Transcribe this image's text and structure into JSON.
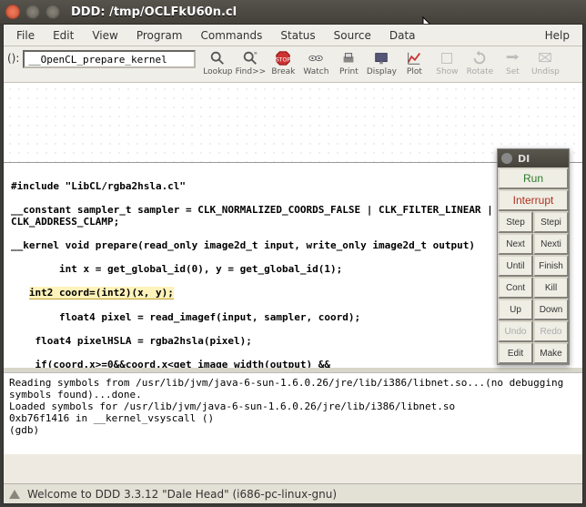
{
  "title": "DDD: /tmp/OCLFkU60n.cl",
  "menubar": [
    "File",
    "Edit",
    "View",
    "Program",
    "Commands",
    "Status",
    "Source",
    "Data"
  ],
  "menubar_help": "Help",
  "func_label": "():",
  "func_input_value": "__OpenCL_prepare_kernel",
  "toolbar": {
    "lookup": "Lookup",
    "find": "Find>>",
    "break": "Break",
    "watch": "Watch",
    "print": "Print",
    "display": "Display",
    "plot": "Plot",
    "show": "Show",
    "rotate": "Rotate",
    "set": "Set",
    "undisp": "Undisp"
  },
  "source_lines": [
    "",
    "#include \"LibCL/rgba2hsla.cl\"",
    "",
    "__constant sampler_t sampler = CLK_NORMALIZED_COORDS_FALSE | CLK_FILTER_LINEAR | ",
    "CLK_ADDRESS_CLAMP;",
    "",
    "__kernel void prepare(read_only image2d_t input, write_only image2d_t output)",
    "",
    "        int x = get_global_id(0), y = get_global_id(1);",
    "",
    "   int2 coord=(int2)(x, y);",
    "",
    "        float4 pixel = read_imagef(input, sampler, coord);",
    "",
    "    float4 pixelHSLA = rgba2hsla(pixel);",
    "",
    "    if(coord.x>=0&&coord.x<get_image_width(output) &&"
  ],
  "highlight_line_index": 10,
  "console_text": "Reading symbols from /usr/lib/jvm/java-6-sun-1.6.0.26/jre/lib/i386/libnet.so...(no debugging symbols found)...done.\nLoaded symbols for /usr/lib/jvm/java-6-sun-1.6.0.26/jre/lib/i386/libnet.so\n0xb76f1416 in __kernel_vsyscall ()\n(gdb) ",
  "status_text": "Welcome to DDD 3.3.12 \"Dale Head\" (i686-pc-linux-gnu)",
  "cmdpanel": {
    "title": "DI",
    "run": "Run",
    "interrupt": "Interrupt",
    "rows": [
      [
        "Step",
        "Stepi"
      ],
      [
        "Next",
        "Nexti"
      ],
      [
        "Until",
        "Finish"
      ],
      [
        "Cont",
        "Kill"
      ],
      [
        "Up",
        "Down"
      ],
      [
        "Undo",
        "Redo"
      ],
      [
        "Edit",
        "Make"
      ]
    ],
    "disabled": [
      "Undo",
      "Redo"
    ]
  }
}
